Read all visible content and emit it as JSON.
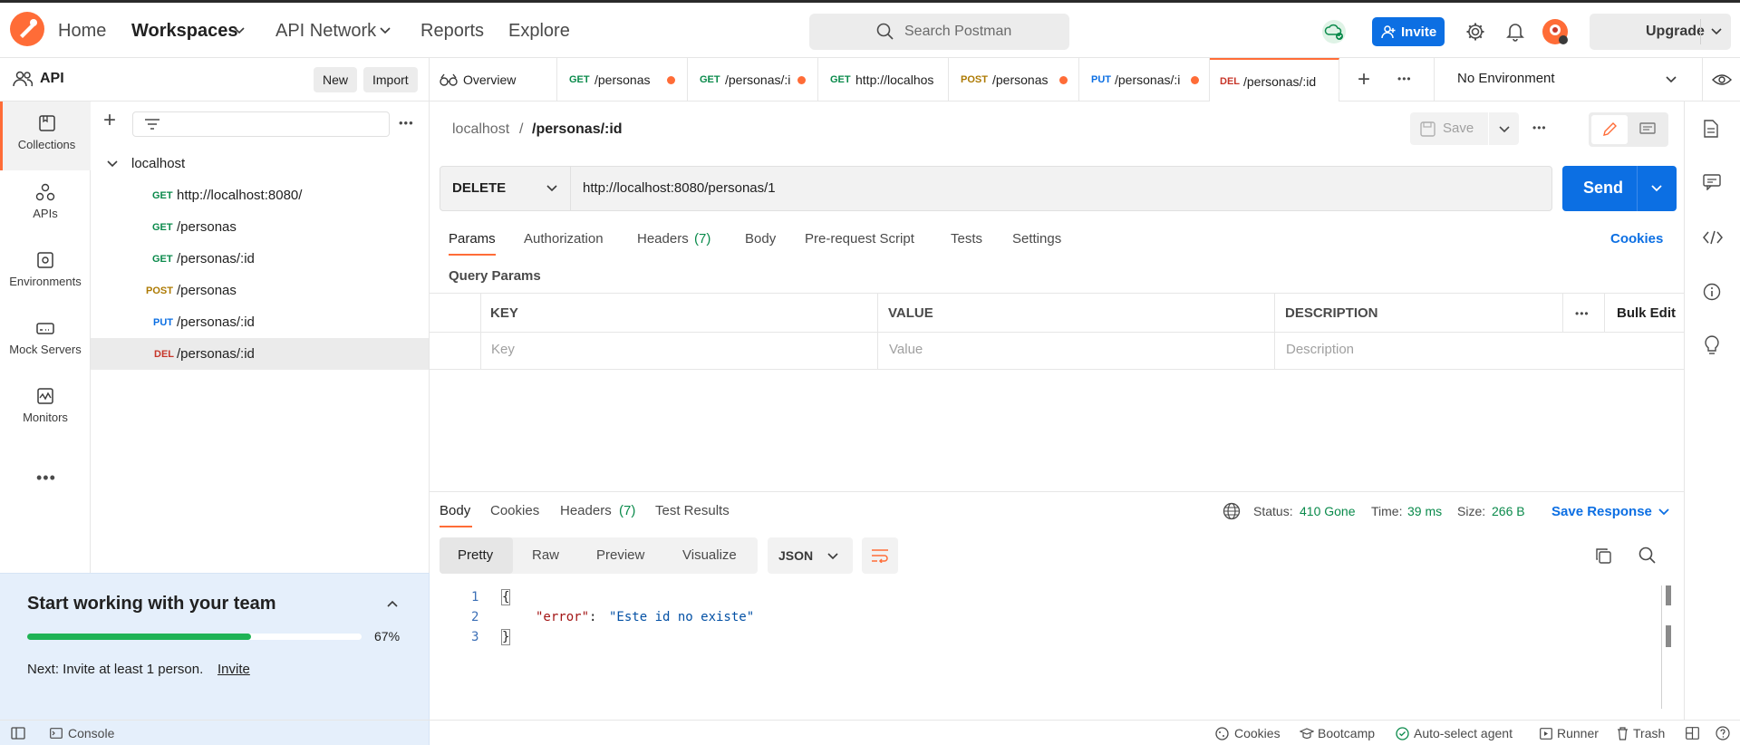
{
  "topbar": {
    "nav": [
      "Home",
      "Workspaces",
      "API Network",
      "Reports",
      "Explore"
    ],
    "search_placeholder": "Search Postman",
    "invite_label": "Invite",
    "upgrade_label": "Upgrade"
  },
  "workspace": {
    "name": "API",
    "new_label": "New",
    "import_label": "Import"
  },
  "rail": [
    {
      "label": "Collections",
      "icon": "collections-icon"
    },
    {
      "label": "APIs",
      "icon": "apis-icon"
    },
    {
      "label": "Environments",
      "icon": "environments-icon"
    },
    {
      "label": "Mock Servers",
      "icon": "mock-servers-icon"
    },
    {
      "label": "Monitors",
      "icon": "monitors-icon"
    }
  ],
  "collection": {
    "name": "localhost",
    "requests": [
      {
        "method": "GET",
        "name": "http://localhost:8080/"
      },
      {
        "method": "GET",
        "name": "/personas"
      },
      {
        "method": "GET",
        "name": "/personas/:id"
      },
      {
        "method": "POST",
        "name": "/personas"
      },
      {
        "method": "PUT",
        "name": "/personas/:id"
      },
      {
        "method": "DEL",
        "name": "/personas/:id"
      }
    ]
  },
  "team_card": {
    "title": "Start working with your team",
    "progress_percent": 67,
    "progress_label": "67%",
    "next_text": "Next: Invite at least 1 person.",
    "invite_link": "Invite"
  },
  "tabs": [
    {
      "method": "",
      "label": "Overview"
    },
    {
      "method": "GET",
      "label": "/personas"
    },
    {
      "method": "GET",
      "label": "/personas/:i"
    },
    {
      "method": "GET",
      "label": "http://localhos"
    },
    {
      "method": "POST",
      "label": "/personas"
    },
    {
      "method": "PUT",
      "label": "/personas/:i"
    },
    {
      "method": "DEL",
      "label": "/personas/:id"
    }
  ],
  "environment": "No Environment",
  "request": {
    "breadcrumb_parent": "localhost",
    "breadcrumb_sep": "/",
    "breadcrumb_name": "/personas/:id",
    "save_label": "Save",
    "method": "DELETE",
    "url": "http://localhost:8080/personas/1",
    "send_label": "Send",
    "tabs": [
      "Params",
      "Authorization",
      "Headers",
      "Body",
      "Pre-request Script",
      "Tests",
      "Settings"
    ],
    "headers_count": "(7)",
    "cookies_label": "Cookies",
    "query_params_label": "Query Params",
    "columns": [
      "KEY",
      "VALUE",
      "DESCRIPTION"
    ],
    "placeholders": [
      "Key",
      "Value",
      "Description"
    ],
    "bulk_edit": "Bulk Edit"
  },
  "response": {
    "tabs": [
      "Body",
      "Cookies",
      "Headers",
      "Test Results"
    ],
    "headers_count": "(7)",
    "status_label": "Status:",
    "status_value": "410 Gone",
    "time_label": "Time:",
    "time_value": "39 ms",
    "size_label": "Size:",
    "size_value": "266 B",
    "save_response": "Save Response",
    "view_modes": [
      "Pretty",
      "Raw",
      "Preview",
      "Visualize"
    ],
    "format": "JSON",
    "lines": [
      "1",
      "2",
      "3"
    ],
    "open_brace": "{",
    "close_brace": "}",
    "json_key": "\"error\"",
    "json_colon": ": ",
    "json_value": "\"Este id no existe\""
  },
  "footer": {
    "console": "Console",
    "cookies": "Cookies",
    "bootcamp": "Bootcamp",
    "auto_select": "Auto-select agent",
    "runner": "Runner",
    "trash": "Trash"
  },
  "colors": {
    "accent": "#ff6c37",
    "primary": "#0c6fe3",
    "success": "#0a8a4b",
    "progress": "#1fb355"
  }
}
